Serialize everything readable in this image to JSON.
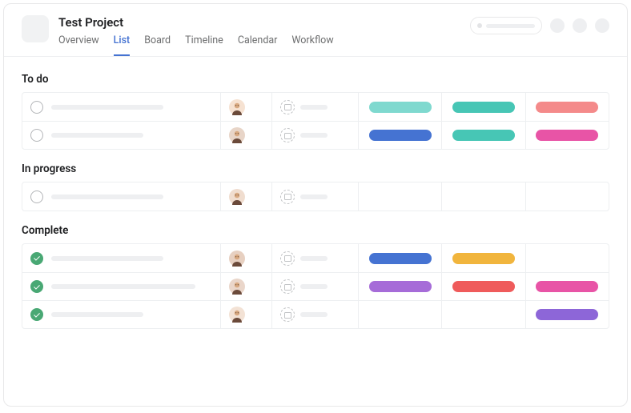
{
  "project": {
    "title": "Test Project"
  },
  "tabs": [
    {
      "label": "Overview",
      "active": false
    },
    {
      "label": "List",
      "active": true
    },
    {
      "label": "Board",
      "active": false
    },
    {
      "label": "Timeline",
      "active": false
    },
    {
      "label": "Calendar",
      "active": false
    },
    {
      "label": "Workflow",
      "active": false
    }
  ],
  "sections": [
    {
      "title": "To do",
      "rows": [
        {
          "done": false,
          "task_width": 140,
          "avatar": "a",
          "tags": [
            "#7fd9cf",
            "#47c6b5",
            "#f48a8a"
          ]
        },
        {
          "done": false,
          "task_width": 115,
          "avatar": "b",
          "tags": [
            "#4573d2",
            "#47c6b5",
            "#e854a6"
          ]
        }
      ]
    },
    {
      "title": "In progress",
      "rows": [
        {
          "done": false,
          "task_width": 140,
          "avatar": "c",
          "tags": [
            null,
            null,
            null
          ]
        }
      ]
    },
    {
      "title": "Complete",
      "rows": [
        {
          "done": true,
          "task_width": 140,
          "avatar": "d",
          "tags": [
            "#4573d2",
            "#f1b53d",
            null
          ]
        },
        {
          "done": true,
          "task_width": 180,
          "avatar": "e",
          "tags": [
            "#a66cd8",
            "#ef5b5b",
            "#e854a6"
          ]
        },
        {
          "done": true,
          "task_width": 115,
          "avatar": "f",
          "tags": [
            null,
            null,
            "#8d66d8"
          ]
        }
      ]
    }
  ]
}
